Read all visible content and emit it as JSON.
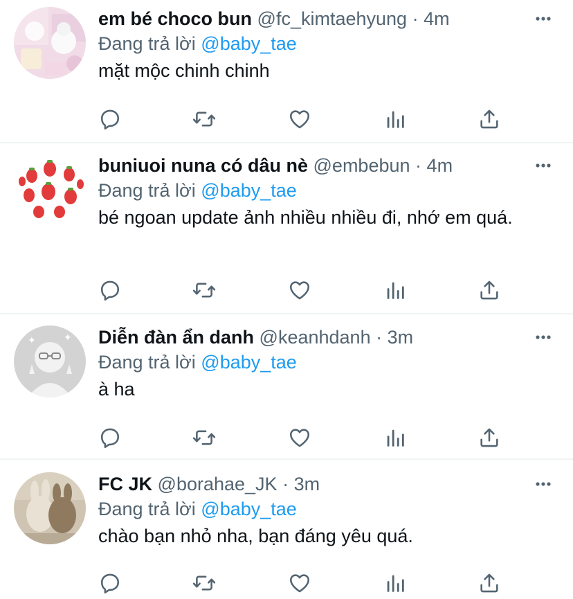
{
  "tweets": [
    {
      "name": "em bé choco bun",
      "handle": "@fc_kimtaehyung",
      "time": "4m",
      "reply_prefix": "Đang trả lời",
      "reply_to": "@baby_tae",
      "text": "mặt mộc chinh chinh"
    },
    {
      "name": "buniuoi nuna có dâu nè",
      "handle": "@embebun",
      "time": "4m",
      "reply_prefix": "Đang trả lời",
      "reply_to": "@baby_tae",
      "text": "bé ngoan update ảnh nhiều nhiều đi, nhớ em quá."
    },
    {
      "name": "Diễn đàn ẩn danh",
      "handle": "@keanhdanh",
      "time": "3m",
      "reply_prefix": "Đang trả lời",
      "reply_to": "@baby_tae",
      "text": "à ha"
    },
    {
      "name": "FC JK",
      "handle": "@borahae_JK",
      "time": "3m",
      "reply_prefix": "Đang trả lời",
      "reply_to": "@baby_tae",
      "text": "chào bạn nhỏ nha, bạn đáng yêu quá."
    }
  ],
  "separator": "·",
  "icons": [
    "reply-icon",
    "retweet-icon",
    "like-icon",
    "analytics-icon",
    "share-icon",
    "more-icon"
  ],
  "colors": {
    "accent": "#1d9bf0",
    "secondary_text": "#536471",
    "primary_text": "#0f1419"
  }
}
